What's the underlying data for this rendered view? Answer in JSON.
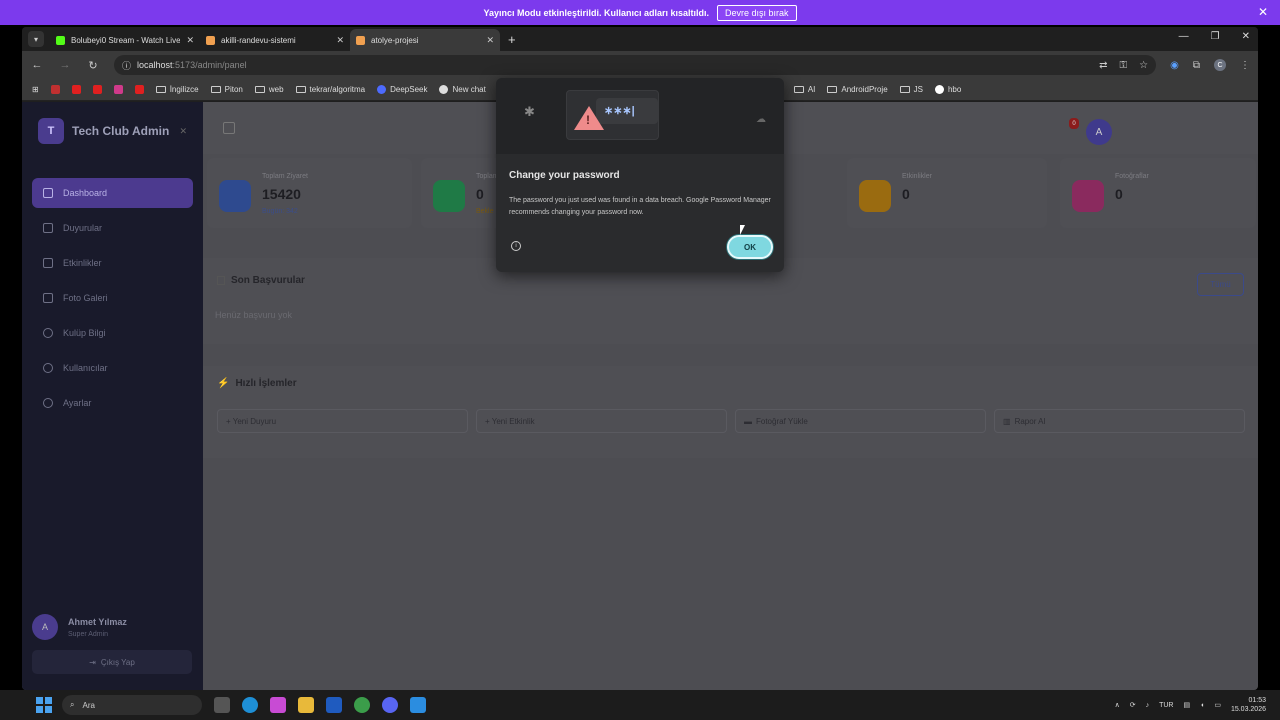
{
  "streamer": {
    "message": "Yayıncı Modu etkinleştirildi. Kullanıcı adları kısaltıldı.",
    "disable_label": "Devre dışı bırak",
    "close": "✕"
  },
  "tabs": [
    {
      "title": "Bolubeyi0 Stream - Watch Live",
      "color": "#53fc18"
    },
    {
      "title": "akilli-randevu-sistemi",
      "color": "#f0a050"
    },
    {
      "title": "atolye-projesi",
      "color": "#f0a050"
    }
  ],
  "window": {
    "minimize": "—",
    "restore": "❐",
    "close": "✕",
    "new_tab": "+",
    "tab_close": "✕"
  },
  "address": {
    "host": "localhost",
    "path": ":5173/admin/panel"
  },
  "bookmarks": [
    "İngilizce",
    "Piton",
    "web",
    "tekrar/algoritma",
    "DeepSeek",
    "New chat",
    "AI",
    "AndroidProje",
    "JS",
    "hbo"
  ],
  "sidebar": {
    "logo_letter": "T",
    "title": "Tech Club Admin",
    "items": [
      "Dashboard",
      "Duyurular",
      "Etkinlikler",
      "Foto Galeri",
      "Kulüp Bilgi",
      "Kullanıcılar",
      "Ayarlar"
    ],
    "user_initial": "A",
    "user_name": "Ahmet Yılmaz",
    "user_role": "Super Admin",
    "logout": "Çıkış Yap"
  },
  "topbar": {
    "notif_count": "0",
    "avatar_initial": "A"
  },
  "stats": [
    {
      "label": "Toplam Ziyaret",
      "value": "15420",
      "sub": "Bugün: 342",
      "color": "#2e4a8f"
    },
    {
      "label": "Toplam",
      "value": "0",
      "sub": "Bekle",
      "color": "#1f7a46"
    },
    {
      "label": "Etkinlikler",
      "value": "0",
      "sub": "",
      "color": "#9a6b10"
    },
    {
      "label": "Fotoğraflar",
      "value": "0",
      "sub": "",
      "color": "#8a2a5e"
    }
  ],
  "recent": {
    "title": "Son Başvurular",
    "all_button": "Tümü",
    "empty": "Henüz başvuru yok"
  },
  "quick": {
    "title": "Hızlı İşlemler",
    "actions": [
      "+ Yeni Duyuru",
      "+ Yeni Etkinlik",
      "Fotoğraf Yükle",
      "Rapor Al"
    ]
  },
  "dialog": {
    "title": "Change your password",
    "body": "The password you just used was found in a data breach. Google Password Manager recommends changing your password now.",
    "ok": "OK",
    "field_dots": "∗∗∗|"
  },
  "taskbar": {
    "search": "Ara",
    "lang": "TUR",
    "time": "01:53",
    "date": "15.03.2026"
  }
}
